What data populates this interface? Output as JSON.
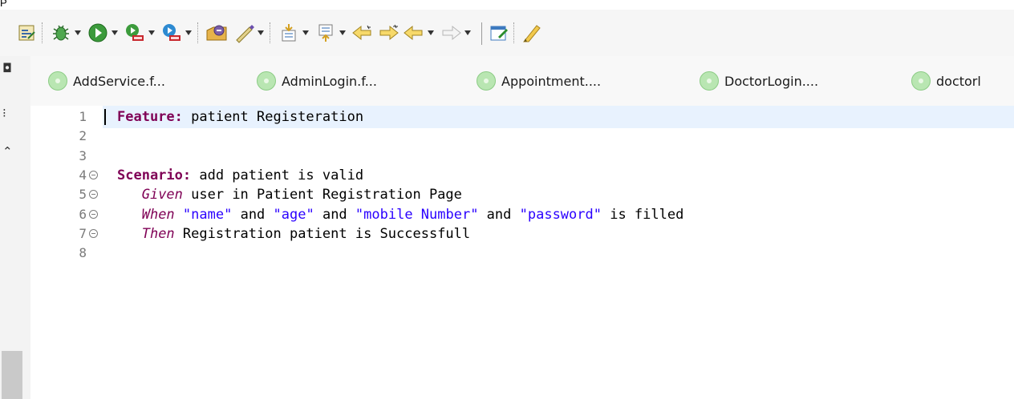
{
  "window": {
    "title_fragment": "P"
  },
  "toolbar": {
    "buttons": [
      {
        "name": "properties-icon"
      },
      {
        "name": "debug-icon",
        "dropdown": true
      },
      {
        "name": "run-icon",
        "dropdown": true
      },
      {
        "name": "run-last-tool-icon",
        "dropdown": true
      },
      {
        "name": "external-tools-icon",
        "dropdown": true
      },
      {
        "name": "open-type-icon"
      },
      {
        "name": "open-task-icon",
        "dropdown": true
      },
      {
        "name": "next-annotation-icon",
        "dropdown": true
      },
      {
        "name": "previous-annotation-icon",
        "dropdown": true
      },
      {
        "name": "last-edit-location-icon"
      },
      {
        "name": "next-edit-location-icon"
      },
      {
        "name": "back-icon",
        "dropdown": true
      },
      {
        "name": "forward-icon",
        "dropdown": true
      },
      {
        "name": "edit-icon"
      },
      {
        "name": "highlight-icon"
      }
    ]
  },
  "tabs": [
    {
      "label": "AddService.f..."
    },
    {
      "label": "AdminLogin.f..."
    },
    {
      "label": "Appointment...."
    },
    {
      "label": "DoctorLogin...."
    },
    {
      "label": "doctorl"
    }
  ],
  "editor": {
    "lines": [
      {
        "number": "1",
        "fold": false,
        "parts": [
          {
            "cls": "kw",
            "text": "Feature:"
          },
          {
            "cls": "txt",
            "text": " patient Registeration"
          }
        ]
      },
      {
        "number": "2",
        "fold": false,
        "parts": []
      },
      {
        "number": "3",
        "fold": false,
        "parts": []
      },
      {
        "number": "4",
        "fold": true,
        "parts": [
          {
            "cls": "kw",
            "text": "Scenario:"
          },
          {
            "cls": "txt",
            "text": " add patient is valid"
          }
        ]
      },
      {
        "number": "5",
        "fold": true,
        "parts": [
          {
            "cls": "txt",
            "text": "   "
          },
          {
            "cls": "step",
            "text": "Given"
          },
          {
            "cls": "txt",
            "text": " user in Patient Registration Page"
          }
        ]
      },
      {
        "number": "6",
        "fold": true,
        "parts": [
          {
            "cls": "txt",
            "text": "   "
          },
          {
            "cls": "step",
            "text": "When"
          },
          {
            "cls": "txt",
            "text": " "
          },
          {
            "cls": "str",
            "text": "\"name\""
          },
          {
            "cls": "txt",
            "text": " and "
          },
          {
            "cls": "str",
            "text": "\"age\""
          },
          {
            "cls": "txt",
            "text": " and "
          },
          {
            "cls": "str",
            "text": "\"mobile Number\""
          },
          {
            "cls": "txt",
            "text": " and "
          },
          {
            "cls": "str",
            "text": "\"password\""
          },
          {
            "cls": "txt",
            "text": " is filled"
          }
        ]
      },
      {
        "number": "7",
        "fold": true,
        "parts": [
          {
            "cls": "txt",
            "text": "   "
          },
          {
            "cls": "step",
            "text": "Then"
          },
          {
            "cls": "txt",
            "text": " Registration patient is Successfull"
          }
        ]
      },
      {
        "number": "8",
        "fold": false,
        "parts": []
      }
    ]
  },
  "colors": {
    "keyword": "#7f0055",
    "string": "#2a00ff",
    "current_line": "#e8f2fe",
    "feature_file_icon": "#b9e6b2"
  }
}
